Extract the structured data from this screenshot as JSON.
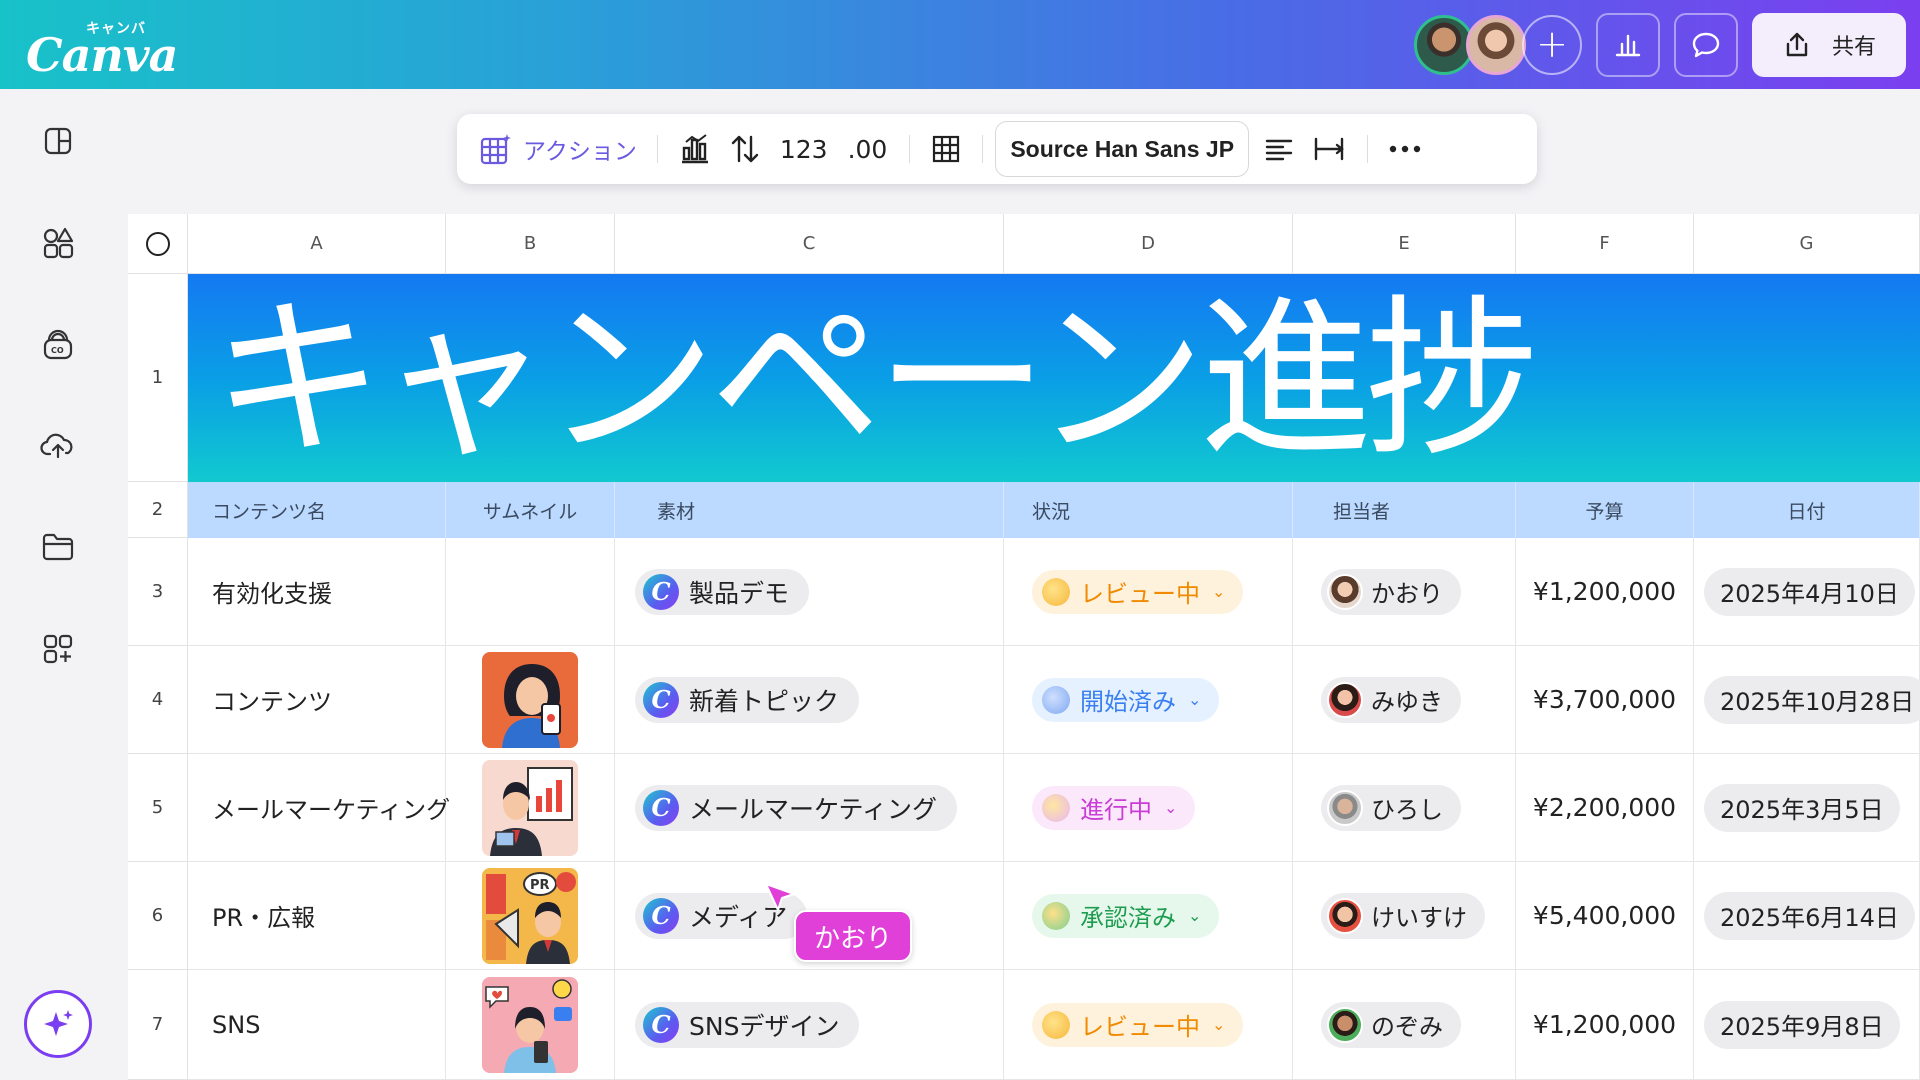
{
  "app": {
    "logo_kana": "キャンバ",
    "logo_word": "Canva",
    "share_label": "共有"
  },
  "toolbar": {
    "action_label": "アクション",
    "number_format": "123",
    "decimal_format": ".00",
    "font_name": "Source Han Sans JP"
  },
  "sheet": {
    "columns": [
      "A",
      "B",
      "C",
      "D",
      "E",
      "F",
      "G"
    ],
    "row_numbers": [
      "1",
      "2",
      "3",
      "4",
      "5",
      "6",
      "7"
    ],
    "banner_title": "キャンペーン進捗",
    "headers": {
      "name": "コンテンツ名",
      "thumb": "サムネイル",
      "material": "素材",
      "status": "状況",
      "owner": "担当者",
      "budget": "予算",
      "date": "日付"
    },
    "rows": [
      {
        "name": "有効化支援",
        "material": "製品デモ",
        "status": "レビュー中",
        "status_kind": "review",
        "owner": "かおり",
        "budget": "¥1,200,000",
        "date": "2025年4月10日"
      },
      {
        "name": "コンテンツ",
        "material": "新着トピック",
        "status": "開始済み",
        "status_kind": "started",
        "owner": "みゆき",
        "budget": "¥3,700,000",
        "date": "2025年10月28日"
      },
      {
        "name": "メールマーケティング",
        "material": "メールマーケティング",
        "status": "進行中",
        "status_kind": "progress",
        "owner": "ひろし",
        "budget": "¥2,200,000",
        "date": "2025年3月5日"
      },
      {
        "name": "PR・広報",
        "material": "メディア",
        "status": "承認済み",
        "status_kind": "approved",
        "owner": "けいすけ",
        "budget": "¥5,400,000",
        "date": "2025年6月14日"
      },
      {
        "name": "SNS",
        "material": "SNSデザイン",
        "status": "レビュー中",
        "status_kind": "review",
        "owner": "のぞみ",
        "budget": "¥1,200,000",
        "date": "2025年9月8日"
      }
    ]
  },
  "collaborator_cursor": {
    "label": "かおり",
    "color": "#e040d8"
  },
  "colors": {
    "brand_gradient_start": "#18c2c9",
    "brand_gradient_end": "#7b3ff0",
    "header_row": "#bcd9ff",
    "banner_start": "#1479f2",
    "banner_end": "#11c9cf"
  },
  "icons": {
    "sidebar": [
      "layout-panel-icon",
      "elements-icon",
      "brand-kit-icon",
      "upload-cloud-icon",
      "folder-icon",
      "apps-icon"
    ],
    "magic": "magic-sparkle-icon",
    "top": [
      "plus-icon",
      "insights-chart-icon",
      "comment-icon",
      "share-upload-icon"
    ]
  }
}
